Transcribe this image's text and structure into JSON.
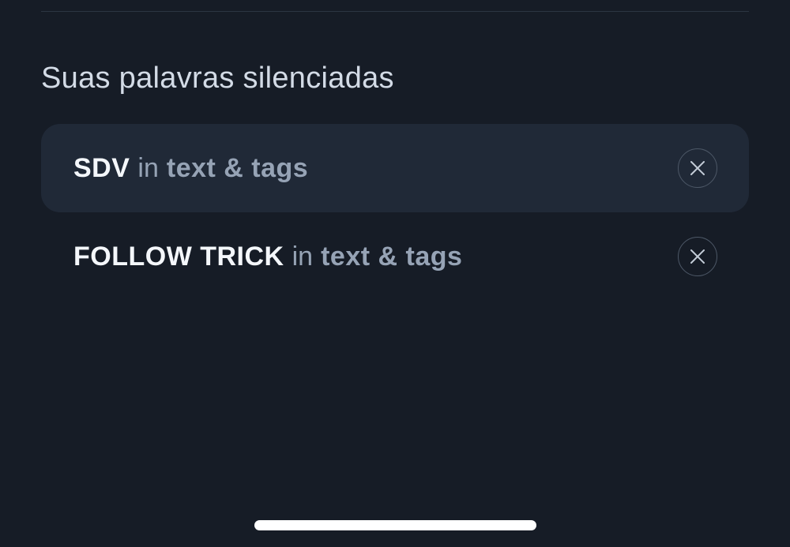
{
  "section": {
    "title": "Suas palavras silenciadas"
  },
  "muted_words": [
    {
      "word": "SDV",
      "in_label": "in",
      "scope": "text & tags",
      "highlighted": true,
      "remove_icon": "close-icon"
    },
    {
      "word": "FOLLOW TRICK",
      "in_label": "in",
      "scope": "text & tags",
      "highlighted": false,
      "remove_icon": "close-icon"
    }
  ],
  "colors": {
    "background": "#161c26",
    "row_highlight": "#202937",
    "word": "#f4f7fb",
    "secondary_text": "#96a3b5",
    "title": "#d3dbe6",
    "divider": "#2c3542"
  }
}
